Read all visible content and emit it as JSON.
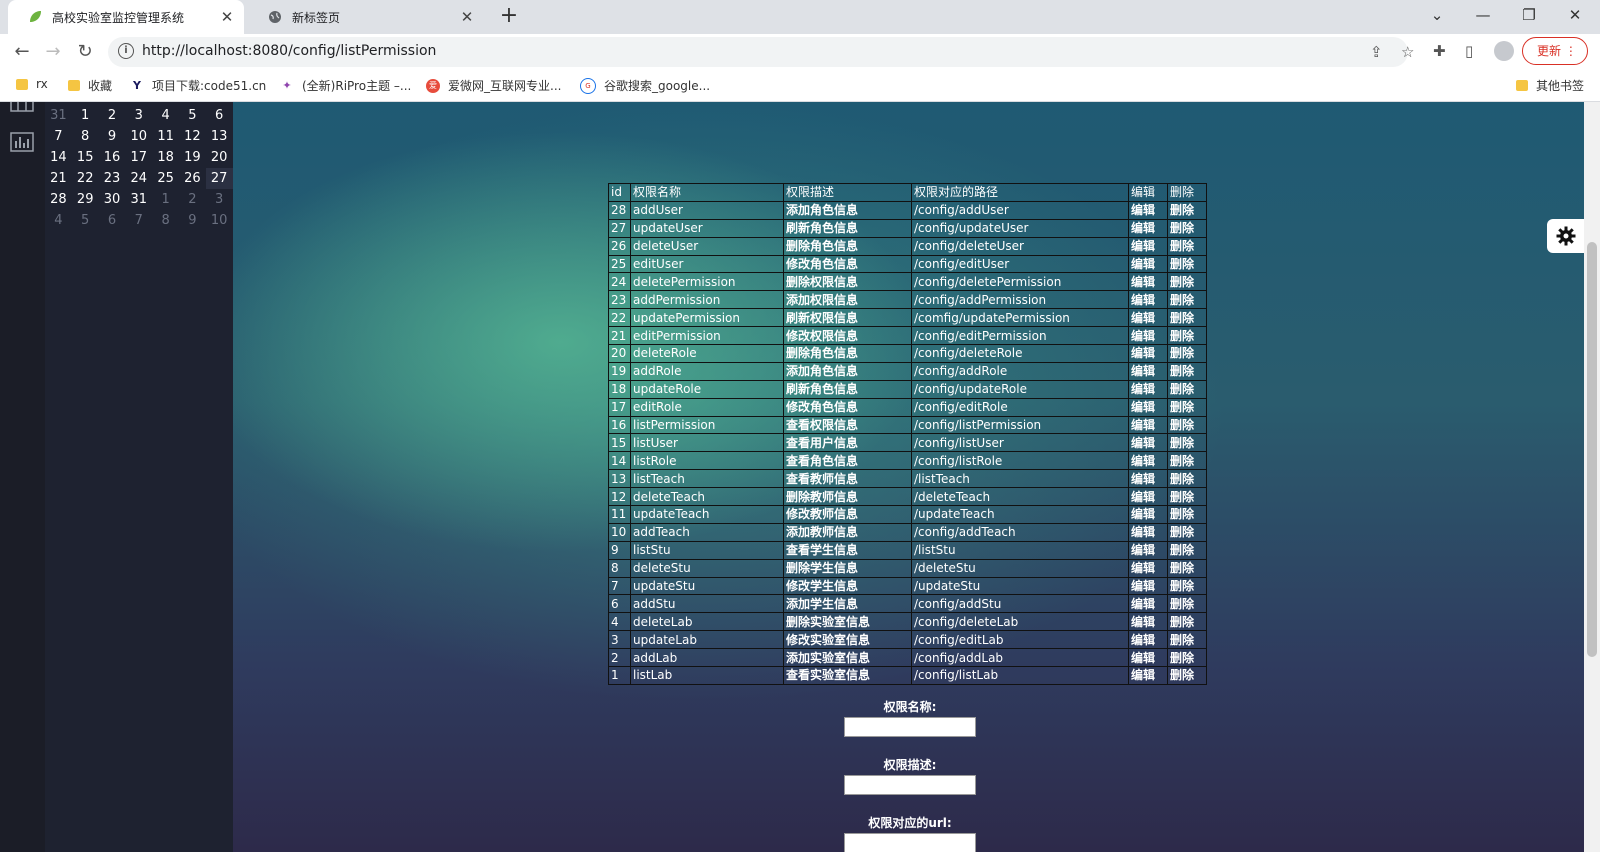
{
  "browser": {
    "tabs": [
      {
        "title": "高校实验室监控管理系统",
        "active": true
      },
      {
        "title": "新标签页",
        "active": false
      }
    ],
    "url": "http://localhost:8080/config/listPermission",
    "update_label": "更新",
    "bookmarks": [
      "rx",
      "收藏",
      "项目下载:code51.cn",
      "(全新)RiPro主题 –...",
      "爱微网_互联网专业...",
      "谷歌搜索_google..."
    ],
    "other_bookmarks": "其他书签"
  },
  "calendar": {
    "weeks": [
      [
        {
          "d": "31",
          "m": true
        },
        {
          "d": "1"
        },
        {
          "d": "2"
        },
        {
          "d": "3"
        },
        {
          "d": "4"
        },
        {
          "d": "5"
        },
        {
          "d": "6"
        }
      ],
      [
        {
          "d": "7"
        },
        {
          "d": "8"
        },
        {
          "d": "9"
        },
        {
          "d": "10"
        },
        {
          "d": "11"
        },
        {
          "d": "12"
        },
        {
          "d": "13"
        }
      ],
      [
        {
          "d": "14"
        },
        {
          "d": "15"
        },
        {
          "d": "16"
        },
        {
          "d": "17"
        },
        {
          "d": "18"
        },
        {
          "d": "19"
        },
        {
          "d": "20"
        }
      ],
      [
        {
          "d": "21"
        },
        {
          "d": "22"
        },
        {
          "d": "23"
        },
        {
          "d": "24"
        },
        {
          "d": "25"
        },
        {
          "d": "26"
        },
        {
          "d": "27",
          "t": true
        }
      ],
      [
        {
          "d": "28"
        },
        {
          "d": "29"
        },
        {
          "d": "30"
        },
        {
          "d": "31"
        },
        {
          "d": "1",
          "m": true
        },
        {
          "d": "2",
          "m": true
        },
        {
          "d": "3",
          "m": true
        }
      ],
      [
        {
          "d": "4",
          "m": true
        },
        {
          "d": "5",
          "m": true
        },
        {
          "d": "6",
          "m": true
        },
        {
          "d": "7",
          "m": true
        },
        {
          "d": "8",
          "m": true
        },
        {
          "d": "9",
          "m": true
        },
        {
          "d": "10",
          "m": true
        }
      ]
    ]
  },
  "table": {
    "headers": [
      "id",
      "权限名称",
      "权限描述",
      "权限对应的路径",
      "编辑",
      "删除"
    ],
    "edit_label": "编辑",
    "delete_label": "删除",
    "rows": [
      [
        "28",
        "addUser",
        "添加角色信息",
        "/config/addUser"
      ],
      [
        "27",
        "updateUser",
        "刷新角色信息",
        "/config/updateUser"
      ],
      [
        "26",
        "deleteUser",
        "删除角色信息",
        "/config/deleteUser"
      ],
      [
        "25",
        "editUser",
        "修改角色信息",
        "/config/editUser"
      ],
      [
        "24",
        "deletePermission",
        "删除权限信息",
        "/config/deletePermission"
      ],
      [
        "23",
        "addPermission",
        "添加权限信息",
        "/config/addPermission"
      ],
      [
        "22",
        "updatePermission",
        "刷新权限信息",
        "/comfig/updatePermission"
      ],
      [
        "21",
        "editPermission",
        "修改权限信息",
        "/config/editPermission"
      ],
      [
        "20",
        "deleteRole",
        "删除角色信息",
        "/config/deleteRole"
      ],
      [
        "19",
        "addRole",
        "添加角色信息",
        "/config/addRole"
      ],
      [
        "18",
        "updateRole",
        "刷新角色信息",
        "/config/updateRole"
      ],
      [
        "17",
        "editRole",
        "修改角色信息",
        "/config/editRole"
      ],
      [
        "16",
        "listPermission",
        "查看权限信息",
        "/config/listPermission"
      ],
      [
        "15",
        "listUser",
        "查看用户信息",
        "/config/listUser"
      ],
      [
        "14",
        "listRole",
        "查看角色信息",
        "/config/listRole"
      ],
      [
        "13",
        "listTeach",
        "查看教师信息",
        "/listTeach"
      ],
      [
        "12",
        "deleteTeach",
        "删除教师信息",
        "/deleteTeach"
      ],
      [
        "11",
        "updateTeach",
        "修改教师信息",
        "/updateTeach"
      ],
      [
        "10",
        "addTeach",
        "添加教师信息",
        "/config/addTeach"
      ],
      [
        "9",
        "listStu",
        "查看学生信息",
        "/listStu"
      ],
      [
        "8",
        "deleteStu",
        "删除学生信息",
        "/deleteStu"
      ],
      [
        "7",
        "updateStu",
        "修改学生信息",
        "/updateStu"
      ],
      [
        "6",
        "addStu",
        "添加学生信息",
        "/config/addStu"
      ],
      [
        "4",
        "deleteLab",
        "删除实验室信息",
        "/config/deleteLab"
      ],
      [
        "3",
        "updateLab",
        "修改实验室信息",
        "/config/editLab"
      ],
      [
        "2",
        "addLab",
        "添加实验室信息",
        "/config/addLab"
      ],
      [
        "1",
        "listLab",
        "查看实验室信息",
        "/config/listLab"
      ]
    ]
  },
  "form": {
    "name_label": "权限名称:",
    "desc_label": "权限描述:",
    "url_label": "权限对应的url:"
  }
}
